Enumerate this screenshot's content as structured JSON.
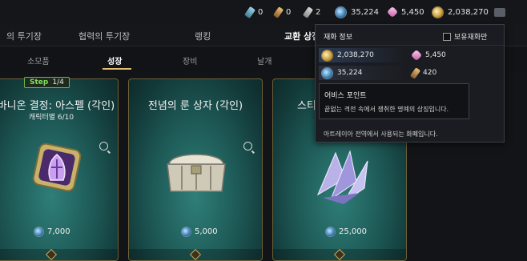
{
  "topbar": {
    "items": [
      {
        "icon": "vial-icon",
        "value": "0"
      },
      {
        "icon": "brush-icon",
        "value": "0"
      },
      {
        "icon": "feather-icon",
        "value": "2"
      },
      {
        "icon": "abyss-point-icon",
        "value": "35,224"
      },
      {
        "icon": "gem-icon",
        "value": "5,450"
      },
      {
        "icon": "gold-coin-icon",
        "value": "2,038,270"
      }
    ]
  },
  "tabs": [
    {
      "label": "의 투기장"
    },
    {
      "label": "협력의 투기장"
    },
    {
      "label": "랭킹"
    },
    {
      "label": "교환 상점",
      "active": true
    }
  ],
  "subtabs": [
    {
      "label": "소모품"
    },
    {
      "label": "성장",
      "active": true
    },
    {
      "label": "장비"
    },
    {
      "label": "날개"
    }
  ],
  "step": {
    "word": "Step",
    "value": "1/4"
  },
  "cards": [
    {
      "title": "에바니온 결정: 아스펠 (각인)",
      "sub": "캐릭터별 6/10",
      "price": "7,000"
    },
    {
      "title": "전념의 룬 상자 (각인)",
      "sub": "",
      "price": "5,000"
    },
    {
      "title": "스티",
      "sub": "",
      "price": "25,000"
    }
  ],
  "tooltip": {
    "title": "재화 정보",
    "checkbox_label": "보유재화만",
    "rows": [
      {
        "value": "2,038,270"
      },
      {
        "value": "5,450"
      },
      {
        "value": "35,224"
      },
      {
        "value": "420"
      }
    ],
    "inner_title": "어비스 포인트",
    "inner_desc": "끝없는 격전 속에서 쟁취한 명예의 상징입니다.",
    "footer": "아트레이아 전역에서 사용되는 화폐입니다."
  },
  "colors": {
    "accent": "#e0c070",
    "step_green": "#7fe05a",
    "card_teal": "#1e5a57"
  }
}
